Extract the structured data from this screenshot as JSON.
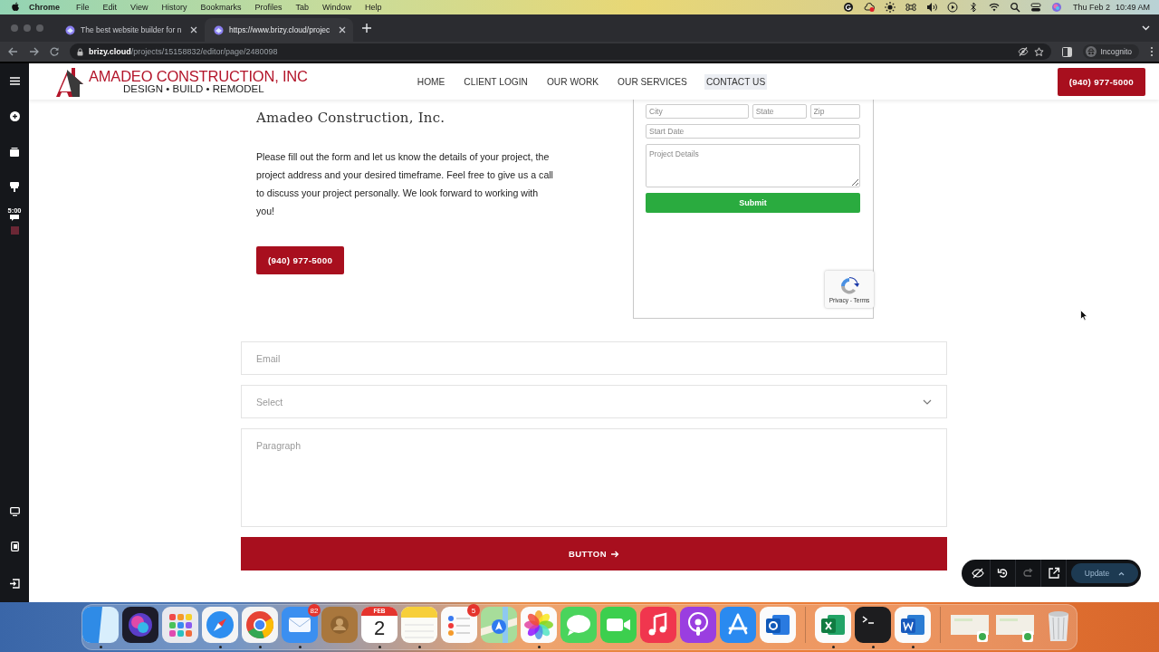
{
  "menubar": {
    "app": "Chrome",
    "menus": [
      "File",
      "Edit",
      "View",
      "History",
      "Bookmarks",
      "Profiles",
      "Tab",
      "Window",
      "Help"
    ],
    "date": "Thu Feb 2",
    "time": "10:49 AM"
  },
  "tabs": [
    {
      "title": "The best website builder for n",
      "selected": false
    },
    {
      "title": "https://www.brizy.cloud/projec",
      "selected": true
    }
  ],
  "address": {
    "host": "brizy.cloud",
    "path": "/projects/15158832/editor/page/2480098"
  },
  "profile": "Incognito",
  "editor_sidebar": {
    "timer": "5:00"
  },
  "site_header": {
    "logo_title": "AMADEO CONSTRUCTION, INC",
    "logo_tagline": "DESIGN • BUILD • REMODEL",
    "nav": [
      {
        "label": "HOME",
        "selected": false
      },
      {
        "label": "CLIENT LOGIN",
        "selected": false
      },
      {
        "label": "OUR WORK",
        "selected": false
      },
      {
        "label": "OUR SERVICES",
        "selected": false
      },
      {
        "label": "CONTACT US",
        "selected": true
      }
    ],
    "phone": "(940) 977-5000"
  },
  "intro": {
    "heading": "Amadeo Construction, Inc.",
    "text": "Please fill out the form and let us know the details of your project, the project address and your desired timeframe. Feel free to give us a call to discuss your project personally. We look forward to working with you!",
    "phone_button": "(940) 977-5000"
  },
  "embed_form": {
    "rows": [
      [
        {
          "placeholder": "City"
        },
        {
          "placeholder": "State"
        },
        {
          "placeholder": "Zip"
        }
      ],
      [
        {
          "placeholder": "Start Date"
        }
      ]
    ],
    "details": {
      "placeholder": "Project Details"
    },
    "submit": "Submit",
    "recaptcha": "Privacy - Terms"
  },
  "contact_form": {
    "fields": [
      {
        "kind": "input",
        "placeholder": "Email"
      },
      {
        "kind": "select",
        "placeholder": "Select"
      },
      {
        "kind": "textarea",
        "placeholder": "Paragraph"
      }
    ],
    "button": "BUTTON"
  },
  "toolbar": {
    "buttons": [
      {
        "kind": "preview",
        "disabled": false
      },
      {
        "kind": "undo",
        "disabled": false
      },
      {
        "kind": "redo",
        "disabled": true
      },
      {
        "kind": "open",
        "disabled": false
      }
    ],
    "update": {
      "label": "Update",
      "disabled": true
    }
  },
  "dock": {
    "apps": [
      {
        "kind": "finder",
        "running": true
      },
      {
        "kind": "siri",
        "running": false
      },
      {
        "kind": "launchpad",
        "running": false
      },
      {
        "kind": "safari",
        "running": true
      },
      {
        "kind": "chrome",
        "running": true
      },
      {
        "kind": "mail",
        "running": true,
        "badge": "82"
      },
      {
        "kind": "contacts",
        "running": false
      },
      {
        "kind": "calendar",
        "running": true,
        "month": "FEB",
        "day": "2"
      },
      {
        "kind": "notes",
        "running": true
      },
      {
        "kind": "reminders",
        "running": false,
        "badge": "5"
      },
      {
        "kind": "maps",
        "running": false
      },
      {
        "kind": "photos",
        "running": true
      },
      {
        "kind": "messages",
        "running": false
      },
      {
        "kind": "facetime",
        "running": false
      },
      {
        "kind": "music",
        "running": false
      },
      {
        "kind": "podcasts",
        "running": false
      },
      {
        "kind": "appstore",
        "running": false
      },
      {
        "kind": "outlook",
        "running": false
      },
      {
        "kind": "separator"
      },
      {
        "kind": "excel",
        "running": true
      },
      {
        "kind": "terminal",
        "running": true
      },
      {
        "kind": "word",
        "running": true
      },
      {
        "kind": "separator"
      },
      {
        "kind": "thumbnail",
        "running": false
      },
      {
        "kind": "thumbnail",
        "running": false
      },
      {
        "kind": "trash",
        "running": false
      }
    ]
  }
}
